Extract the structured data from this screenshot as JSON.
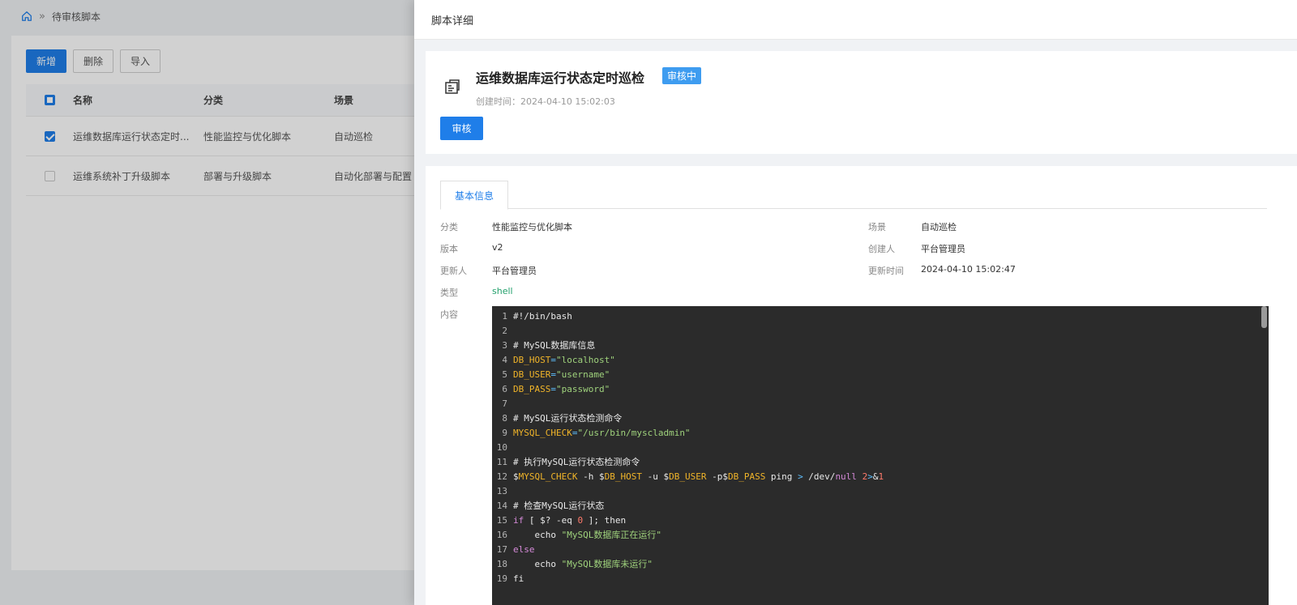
{
  "background": {
    "breadcrumb": {
      "separator": "»",
      "current": "待审核脚本"
    },
    "toolbar": {
      "add": "新增",
      "delete": "删除",
      "import": "导入"
    },
    "table": {
      "headers": {
        "name": "名称",
        "category": "分类",
        "scene": "场景"
      },
      "rows": [
        {
          "name": "运维数据库运行状态定时...",
          "category": "性能监控与优化脚本",
          "scene": "自动巡检",
          "checked": true
        },
        {
          "name": "运维系统补丁升级脚本",
          "category": "部署与升级脚本",
          "scene": "自动化部署与配置",
          "checked": false
        }
      ]
    }
  },
  "drawer": {
    "title": "脚本详细",
    "script": {
      "name": "运维数据库运行状态定时巡检",
      "status": "审核中",
      "created": "创建时间：2024-04-10 15:02:03",
      "review_button": "审核"
    },
    "tab": "基本信息",
    "fields": {
      "category_label": "分类",
      "category": "性能监控与优化脚本",
      "scene_label": "场景",
      "scene": "自动巡检",
      "version_label": "版本",
      "version": "v2",
      "creator_label": "创建人",
      "creator": "平台管理员",
      "updater_label": "更新人",
      "updater": "平台管理员",
      "update_time_label": "更新时间",
      "update_time": "2024-04-10 15:02:47",
      "type_label": "类型",
      "type": "shell",
      "content_label": "内容"
    },
    "code_lines": [
      {
        "n": "1",
        "parts": [
          [
            "c",
            "#!/bin/bash"
          ]
        ]
      },
      {
        "n": "2",
        "parts": []
      },
      {
        "n": "3",
        "parts": [
          [
            "c",
            "# MySQL数据库信息"
          ]
        ]
      },
      {
        "n": "4",
        "parts": [
          [
            "var",
            "DB_HOST"
          ],
          [
            "op",
            "="
          ],
          [
            "str",
            "\"localhost\""
          ]
        ]
      },
      {
        "n": "5",
        "parts": [
          [
            "var",
            "DB_USER"
          ],
          [
            "op",
            "="
          ],
          [
            "str",
            "\"username\""
          ]
        ]
      },
      {
        "n": "6",
        "parts": [
          [
            "var",
            "DB_PASS"
          ],
          [
            "op",
            "="
          ],
          [
            "str",
            "\"password\""
          ]
        ]
      },
      {
        "n": "7",
        "parts": []
      },
      {
        "n": "8",
        "parts": [
          [
            "c",
            "# MySQL运行状态检测命令"
          ]
        ]
      },
      {
        "n": "9",
        "parts": [
          [
            "var",
            "MYSQL_CHECK"
          ],
          [
            "op",
            "="
          ],
          [
            "str",
            "\"/usr/bin/myscladmin\""
          ]
        ]
      },
      {
        "n": "10",
        "parts": []
      },
      {
        "n": "11",
        "parts": [
          [
            "c",
            "# 执行MySQL运行状态检测命令"
          ]
        ]
      },
      {
        "n": "12",
        "parts": [
          [
            "c",
            "$"
          ],
          [
            "var",
            "MYSQL_CHECK"
          ],
          [
            "c",
            " -h $"
          ],
          [
            "var",
            "DB_HOST"
          ],
          [
            "c",
            " -u $"
          ],
          [
            "var",
            "DB_USER"
          ],
          [
            "c",
            " -p$"
          ],
          [
            "var",
            "DB_PASS"
          ],
          [
            "c",
            " ping "
          ],
          [
            "op",
            ">"
          ],
          [
            "c",
            " /dev/"
          ],
          [
            "null",
            "null"
          ],
          [
            "c",
            " "
          ],
          [
            "num",
            "2"
          ],
          [
            "op",
            ">"
          ],
          [
            "c",
            "&"
          ],
          [
            "num",
            "1"
          ]
        ]
      },
      {
        "n": "13",
        "parts": []
      },
      {
        "n": "14",
        "parts": [
          [
            "c",
            "# 检查MySQL运行状态"
          ]
        ]
      },
      {
        "n": "15",
        "parts": [
          [
            "kw",
            "if"
          ],
          [
            "c",
            " [ $? -eq "
          ],
          [
            "num",
            "0"
          ],
          [
            "c",
            " ]; then"
          ]
        ]
      },
      {
        "n": "16",
        "parts": [
          [
            "c",
            "    echo "
          ],
          [
            "str",
            "\"MySQL数据库正在运行\""
          ]
        ]
      },
      {
        "n": "17",
        "parts": [
          [
            "kw",
            "else"
          ]
        ]
      },
      {
        "n": "18",
        "parts": [
          [
            "c",
            "    echo "
          ],
          [
            "str",
            "\"MySQL数据库未运行\""
          ]
        ]
      },
      {
        "n": "19",
        "parts": [
          [
            "c",
            "fi"
          ]
        ]
      }
    ]
  }
}
